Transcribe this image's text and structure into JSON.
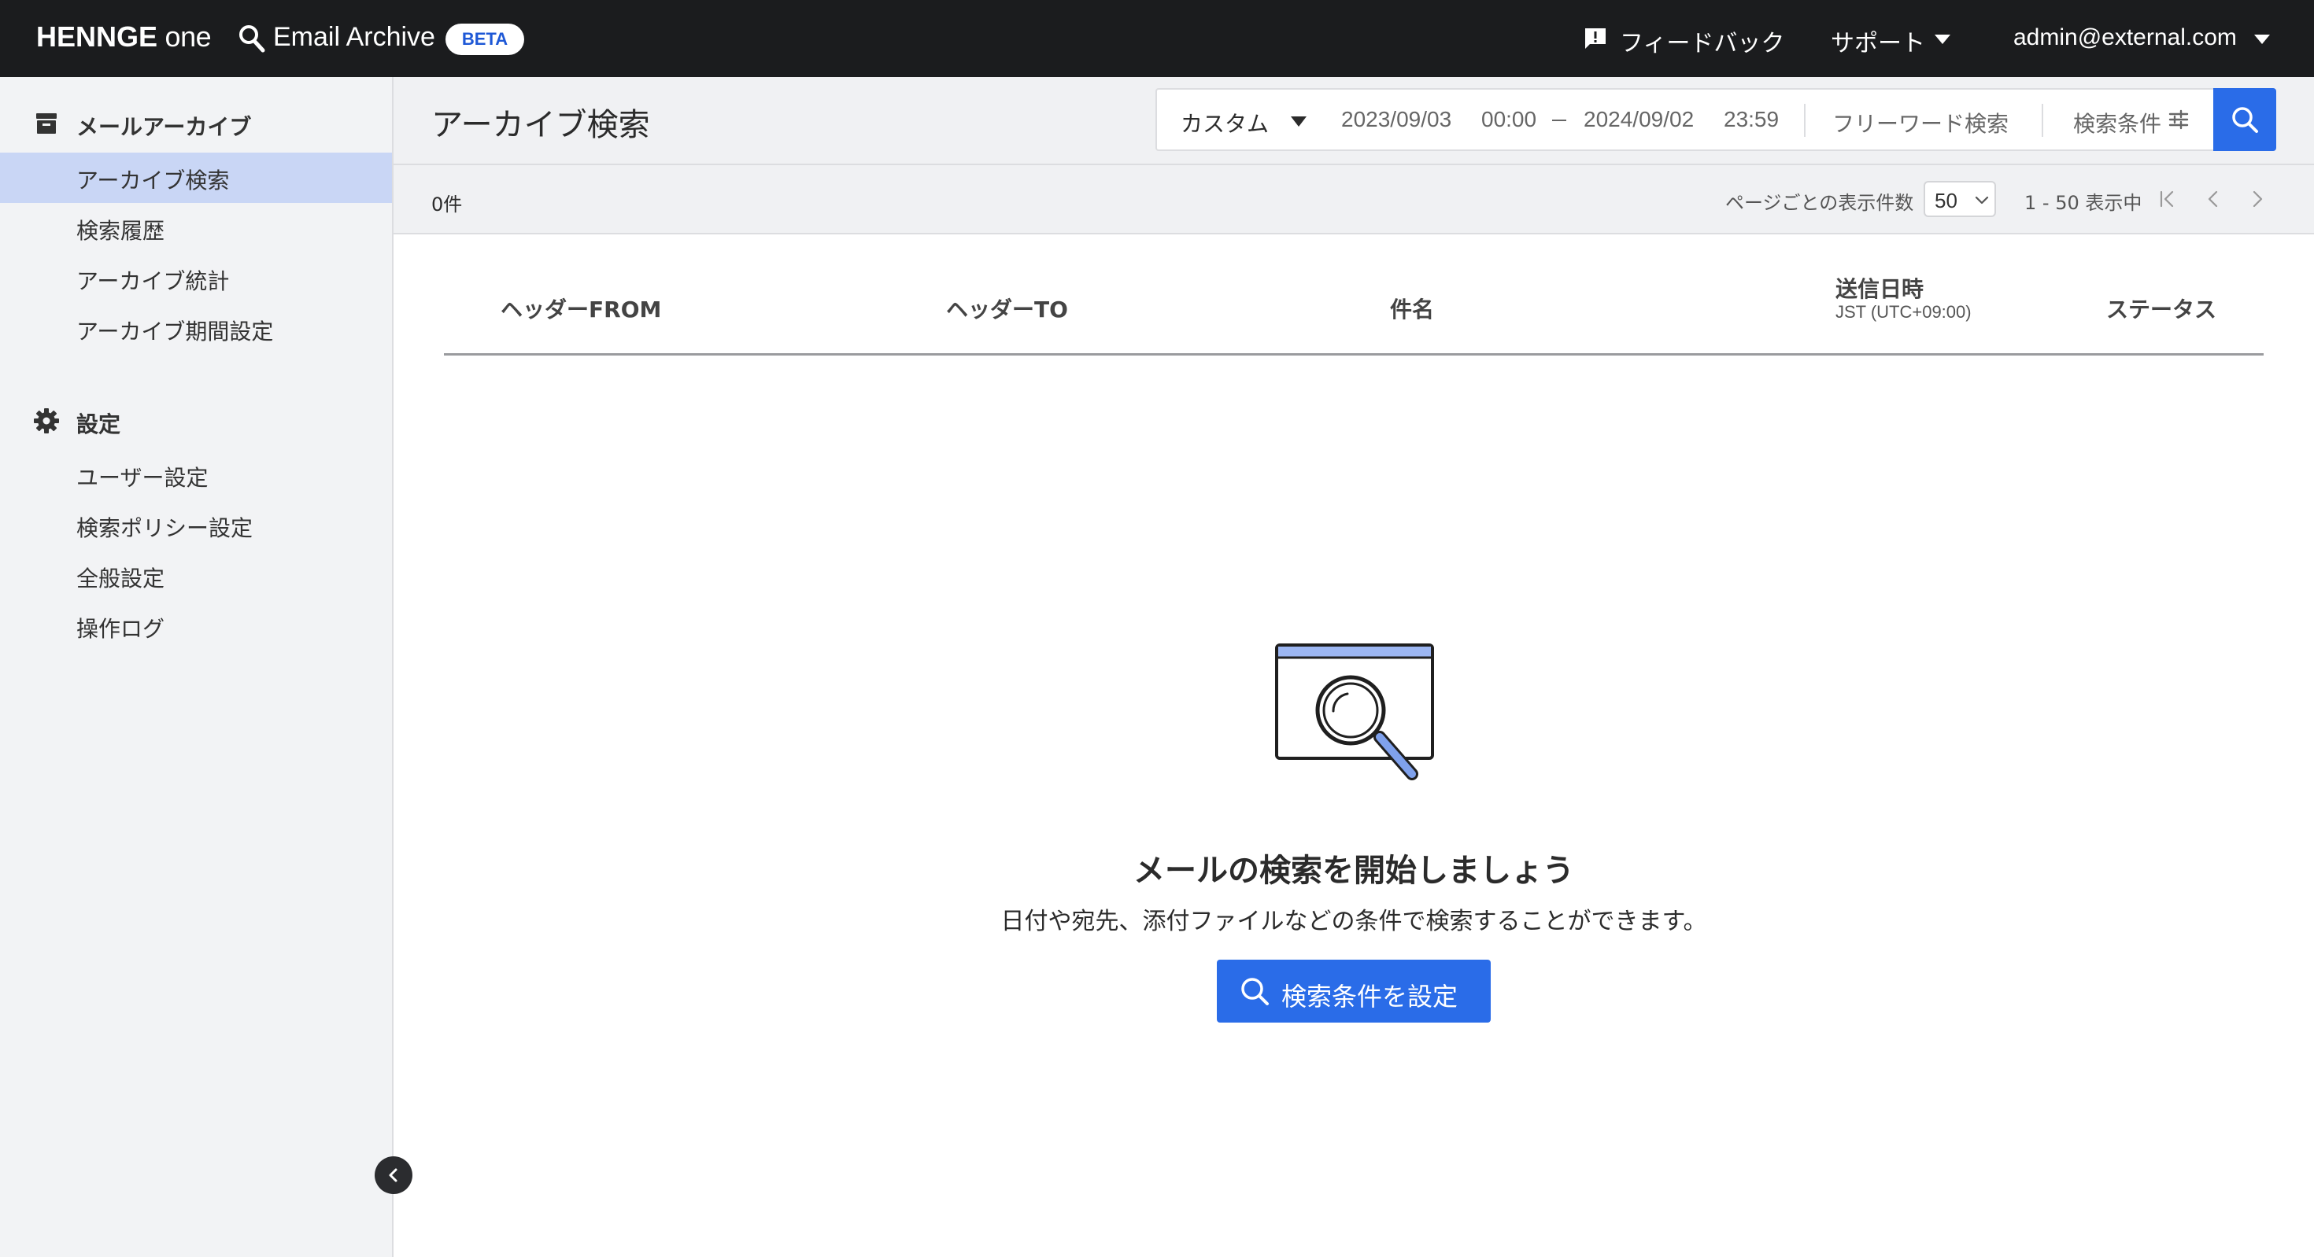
{
  "topbar": {
    "brand_main": "HENNGE",
    "brand_sub": "one",
    "app_name": "Email Archive",
    "beta_badge": "BETA",
    "feedback": "フィードバック",
    "support": "サポート",
    "account": "admin@external.com"
  },
  "sidebar": {
    "sections": [
      {
        "label": "メールアーカイブ",
        "icon": "archive-icon",
        "items": [
          {
            "label": "アーカイブ検索",
            "active": true
          },
          {
            "label": "検索履歴",
            "active": false
          },
          {
            "label": "アーカイブ統計",
            "active": false
          },
          {
            "label": "アーカイブ期間設定",
            "active": false
          }
        ]
      },
      {
        "label": "設定",
        "icon": "gear-icon",
        "items": [
          {
            "label": "ユーザー設定",
            "active": false
          },
          {
            "label": "検索ポリシー設定",
            "active": false
          },
          {
            "label": "全般設定",
            "active": false
          },
          {
            "label": "操作ログ",
            "active": false
          }
        ]
      }
    ]
  },
  "header": {
    "title": "アーカイブ検索",
    "search": {
      "range_mode": "カスタム",
      "from_date": "2023/09/03",
      "from_time": "00:00",
      "to_date": "2024/09/02",
      "to_time": "23:59",
      "free_word_placeholder": "フリーワード検索",
      "conditions_label": "検索条件"
    }
  },
  "results": {
    "count": "0件",
    "per_page_label": "ページごとの表示件数",
    "per_page_value": "50",
    "range_info": "1 - 50 表示中"
  },
  "table": {
    "columns": [
      {
        "label": "ヘッダーFROM"
      },
      {
        "label": "ヘッダーTO"
      },
      {
        "label": "件名"
      },
      {
        "label": "送信日時",
        "sub": "JST (UTC+09:00)"
      },
      {
        "label": "ステータス"
      }
    ]
  },
  "empty_state": {
    "title": "メールの検索を開始しましょう",
    "description": "日付や宛先、添付ファイルなどの条件で検索することができます。",
    "button": "検索条件を設定"
  },
  "colors": {
    "topbar": "#1b1c1e",
    "accent": "#2a6ce8",
    "active_item": "#c9d6f5",
    "sidebar_bg": "#f2f3f5"
  }
}
